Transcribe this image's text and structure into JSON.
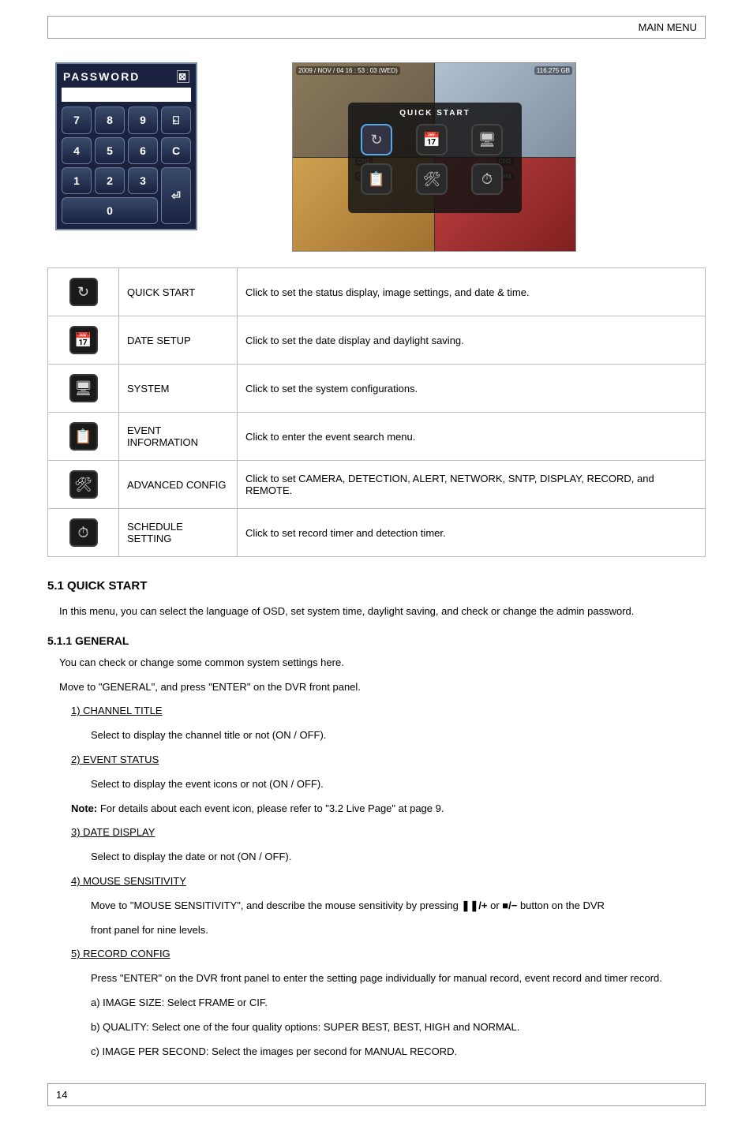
{
  "header": {
    "title": "MAIN MENU"
  },
  "password_panel": {
    "title": "PASSWORD",
    "keys": {
      "k7": "7",
      "k8": "8",
      "k9": "9",
      "back": "⍇",
      "k4": "4",
      "k5": "5",
      "k6": "6",
      "clear": "C",
      "k1": "1",
      "k2": "2",
      "k3": "3",
      "enter": "⏎",
      "k0": "0"
    }
  },
  "screenshot": {
    "osd_datetime": "2009 / NOV / 04  16 : 53 : 03 (WED)",
    "osd_size": "116.275 GB",
    "panel_title": "QUICK START",
    "ch1": "CH1",
    "ch2": "CH2",
    "ch3": "CH3",
    "ch4": "CH4"
  },
  "menu_items": [
    {
      "icon": "↻",
      "name": "QUICK START",
      "label": "QUICK START",
      "desc": "Click to set the status display, image settings, and date & time."
    },
    {
      "icon": "📅",
      "name": "DATE SETUP",
      "label": "DATE SETUP",
      "desc": "Click to set the date display and daylight saving."
    },
    {
      "icon": "🖥",
      "name": "SYSTEM",
      "label": "SYSTEM",
      "desc": "Click to set the system configurations."
    },
    {
      "icon": "📋",
      "name": "EVENT INFORMATION",
      "label": "EVENT INFORMATION",
      "desc": "Click to enter the event search menu."
    },
    {
      "icon": "🛠",
      "name": "ADVANCED CONFIG",
      "label": "ADVANCED CONFIG",
      "desc": "Click to set CAMERA, DETECTION, ALERT, NETWORK, SNTP, DISPLAY, RECORD, and REMOTE."
    },
    {
      "icon": "⏱",
      "name": "SCHEDULE SETTING",
      "label": "SCHEDULE SETTING",
      "desc": "Click to set record timer and detection timer."
    }
  ],
  "sections": {
    "s51": "5.1 QUICK START",
    "s511": "5.1.1 GENERAL",
    "s51_intro": "In this menu, you can select the language of OSD, set system time, daylight saving, and check or change the admin password.",
    "s511_intro": "You can check or change some common system settings here.",
    "s511_intro2": "Move to \"GENERAL\", and press \"ENTER\" on the DVR front panel.",
    "items": {
      "item1_label": "1) CHANNEL TITLE",
      "item1_desc": "Select to display the channel title or not (ON / OFF).",
      "item2_label": "2) EVENT STATUS",
      "item2_desc": "Select to display the event icons or not (ON / OFF).",
      "item2_note_label": "Note:",
      "item2_note": "For details about each event icon, please refer to \"3.2 Live Page\" at page 9.",
      "item3_label": "3) DATE DISPLAY",
      "item3_desc": "Select to display the date or not (ON / OFF).",
      "item4_label": "4) MOUSE SENSITIVITY",
      "item4_desc_a": "Move to \"MOUSE SENSITIVITY\", and describe the mouse sensitivity by pressing  ",
      "item4_desc_b": "  or  ",
      "item4_desc_c": "  button on the DVR",
      "item4_desc2": "front panel for nine levels.",
      "item5_label": "5) RECORD CONFIG",
      "item5_desc": "Press \"ENTER\" on the DVR front panel to enter the setting page individually for manual record, event record and timer record.",
      "item5_a_label": "a) IMAGE SIZE:",
      "item5_a_desc": "Select FRAME or CIF.",
      "item5_b_label": "b) QUALITY:",
      "item5_b_desc": "Select one of the four quality options: SUPER BEST, BEST, HIGH and NORMAL.",
      "item5_c_label": "c) IMAGE PER SECOND:",
      "item5_c_desc": "Select the images per second for MANUAL RECORD."
    }
  },
  "footer": {
    "page": "14"
  },
  "symbols": {
    "pause_plus": "❚❚/+",
    "stop_minus": "■/−"
  }
}
